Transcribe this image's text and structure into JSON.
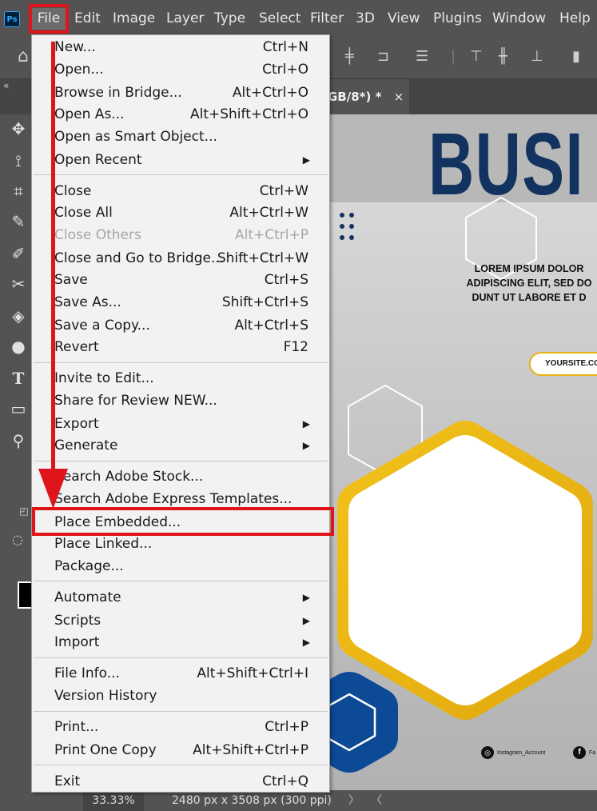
{
  "app": {
    "logo_text": "Ps"
  },
  "menubar": {
    "items": [
      "File",
      "Edit",
      "Image",
      "Layer",
      "Type",
      "Select",
      "Filter",
      "3D",
      "View",
      "Plugins",
      "Window",
      "Help"
    ]
  },
  "document": {
    "tab_title": "GB/8*) *",
    "tab_close": "×"
  },
  "canvas": {
    "title": "BUSI",
    "subtitle_lines": [
      "LOREM IPSUM DOLOR",
      "ADIPISCING ELIT, SED DO",
      "DUNT UT LABORE ET D"
    ],
    "website": "YOURSITE.CO",
    "instagram": "Instagram_Account",
    "facebook": "Fa"
  },
  "file_menu": {
    "items": [
      {
        "label": "New...",
        "shortcut": "Ctrl+N"
      },
      {
        "label": "Open...",
        "shortcut": "Ctrl+O"
      },
      {
        "label": "Browse in Bridge...",
        "shortcut": "Alt+Ctrl+O"
      },
      {
        "label": "Open As...",
        "shortcut": "Alt+Shift+Ctrl+O"
      },
      {
        "label": "Open as Smart Object...",
        "shortcut": ""
      },
      {
        "label": "Open Recent",
        "shortcut": "",
        "submenu": true
      },
      {
        "label": "Close",
        "shortcut": "Ctrl+W"
      },
      {
        "label": "Close All",
        "shortcut": "Alt+Ctrl+W"
      },
      {
        "label": "Close Others",
        "shortcut": "Alt+Ctrl+P",
        "disabled": true
      },
      {
        "label": "Close and Go to Bridge...",
        "shortcut": "Shift+Ctrl+W"
      },
      {
        "label": "Save",
        "shortcut": "Ctrl+S"
      },
      {
        "label": "Save As...",
        "shortcut": "Shift+Ctrl+S"
      },
      {
        "label": "Save a Copy...",
        "shortcut": "Alt+Ctrl+S"
      },
      {
        "label": "Revert",
        "shortcut": "F12"
      },
      {
        "label": "Invite to Edit...",
        "shortcut": ""
      },
      {
        "label": "Share for Review NEW...",
        "shortcut": ""
      },
      {
        "label": "Export",
        "shortcut": "",
        "submenu": true
      },
      {
        "label": "Generate",
        "shortcut": "",
        "submenu": true
      },
      {
        "label": "Search Adobe Stock...",
        "shortcut": ""
      },
      {
        "label": "Search Adobe Express Templates...",
        "shortcut": ""
      },
      {
        "label": "Place Embedded...",
        "shortcut": "",
        "highlighted": true
      },
      {
        "label": "Place Linked...",
        "shortcut": ""
      },
      {
        "label": "Package...",
        "shortcut": ""
      },
      {
        "label": "Automate",
        "shortcut": "",
        "submenu": true
      },
      {
        "label": "Scripts",
        "shortcut": "",
        "submenu": true
      },
      {
        "label": "Import",
        "shortcut": "",
        "submenu": true
      },
      {
        "label": "File Info...",
        "shortcut": "Alt+Shift+Ctrl+I"
      },
      {
        "label": "Version History",
        "shortcut": ""
      },
      {
        "label": "Print...",
        "shortcut": "Ctrl+P"
      },
      {
        "label": "Print One Copy",
        "shortcut": "Alt+Shift+Ctrl+P"
      },
      {
        "label": "Exit",
        "shortcut": "Ctrl+Q"
      }
    ]
  },
  "statusbar": {
    "zoom": "33.33%",
    "doc_size": "2480 px x 3508 px (300 ppi)",
    "arrow_right": "〉",
    "arrow_left": "〈"
  },
  "colors": {
    "highlight_red": "#e0141b",
    "brand_navy": "#12335f",
    "accent_yellow": "#e8b416"
  },
  "icons": {
    "toolbar": [
      "move-icon",
      "lasso-icon",
      "crop-icon",
      "eyedropper-icon",
      "brush-icon",
      "healing-icon",
      "bucket-icon",
      "dodge-icon",
      "type-icon",
      "rectangle-icon",
      "zoom-icon"
    ]
  }
}
